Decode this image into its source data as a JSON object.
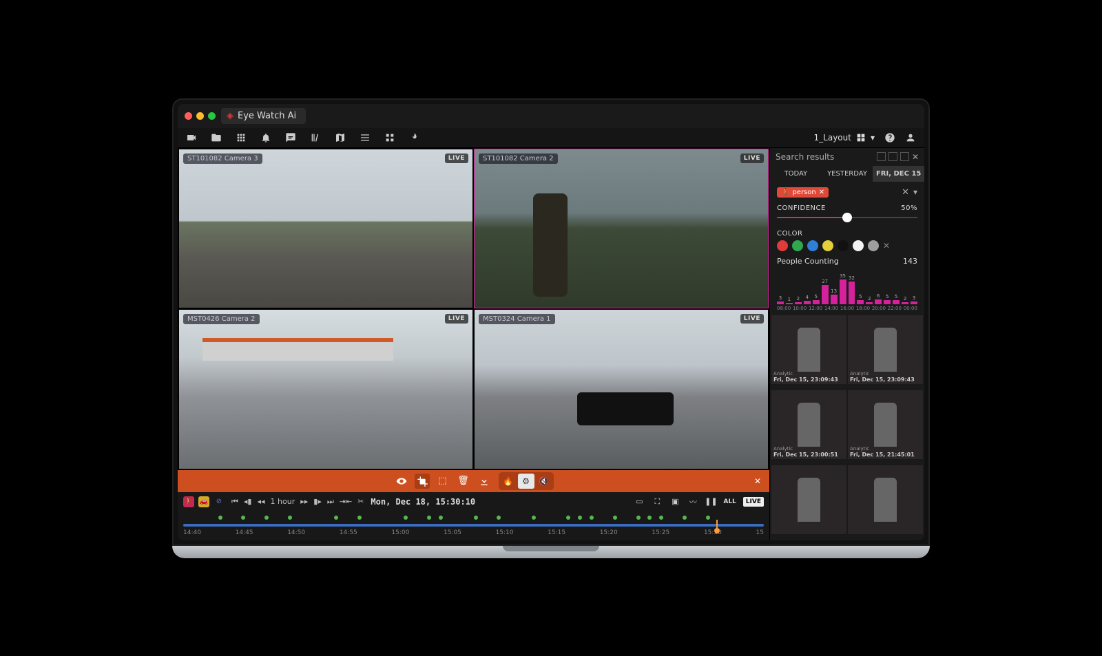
{
  "app": {
    "title": "Eye Watch Ai"
  },
  "toolbar": {
    "layout_label": "1_Layout"
  },
  "cameras": [
    {
      "name": "ST101082 Camera 3",
      "live": "LIVE",
      "selected": false
    },
    {
      "name": "ST101082 Camera 2",
      "live": "LIVE",
      "selected": true
    },
    {
      "name": "MST0426 Camera 2",
      "live": "LIVE",
      "selected": false
    },
    {
      "name": "MST0324 Camera 1",
      "live": "LIVE",
      "selected": false
    }
  ],
  "playback": {
    "speed_label": "1 hour",
    "timestamp": "Mon, Dec 18, 15:30:10",
    "all_label": "ALL",
    "live_label": "LIVE"
  },
  "timeline": {
    "ticks": [
      "14:40",
      "14:45",
      "14:50",
      "14:55",
      "15:00",
      "15:05",
      "15:10",
      "15:15",
      "15:20",
      "15:25",
      "15:30",
      "15"
    ],
    "events": [
      6,
      10,
      14,
      18,
      26,
      30,
      38,
      42,
      44,
      50,
      54,
      60,
      66,
      68,
      70,
      74,
      78,
      80,
      82,
      86,
      90
    ]
  },
  "sidebar": {
    "title": "Search results",
    "tabs": [
      "TODAY",
      "YESTERDAY",
      "FRI, DEC 15"
    ],
    "active_tab": 2,
    "filter_chip": "person",
    "confidence_label": "CONFIDENCE",
    "confidence_value": "50%",
    "confidence_pct": 50,
    "color_label": "COLOR",
    "colors": [
      "#e03a3a",
      "#2fa84f",
      "#2f7fd6",
      "#e5cf3a",
      "#111",
      "#f2f2f2",
      "#9e9e9e"
    ],
    "counting_label": "People Counting",
    "counting_total": "143",
    "results": [
      {
        "source": "Analytic",
        "time": "Fri, Dec 15, 23:09:43"
      },
      {
        "source": "Analytic",
        "time": "Fri, Dec 15, 23:09:43"
      },
      {
        "source": "Analytic",
        "time": "Fri, Dec 15, 23:00:51"
      },
      {
        "source": "Analytic",
        "time": "Fri, Dec 15, 21:45:01"
      },
      {
        "source": "",
        "time": ""
      },
      {
        "source": "",
        "time": ""
      }
    ]
  },
  "chart_data": {
    "type": "bar",
    "title": "People Counting",
    "categories": [
      "08:00",
      "10:00",
      "12:00",
      "14:00",
      "16:00",
      "18:00",
      "20:00",
      "22:00",
      "00:00"
    ],
    "bars": [
      {
        "hour": "08",
        "value": 3
      },
      {
        "hour": "09",
        "value": 1
      },
      {
        "hour": "10",
        "value": 2
      },
      {
        "hour": "11",
        "value": 4
      },
      {
        "hour": "12",
        "value": 5
      },
      {
        "hour": "13",
        "value": 27
      },
      {
        "hour": "14",
        "value": 13
      },
      {
        "hour": "15",
        "value": 35
      },
      {
        "hour": "16",
        "value": 32
      },
      {
        "hour": "17",
        "value": 5
      },
      {
        "hour": "18",
        "value": 2
      },
      {
        "hour": "19",
        "value": 6
      },
      {
        "hour": "20",
        "value": 5
      },
      {
        "hour": "21",
        "value": 5
      },
      {
        "hour": "22",
        "value": 2
      },
      {
        "hour": "23",
        "value": 3
      }
    ],
    "ylim": [
      0,
      35
    ],
    "xlabel": "",
    "ylabel": ""
  }
}
